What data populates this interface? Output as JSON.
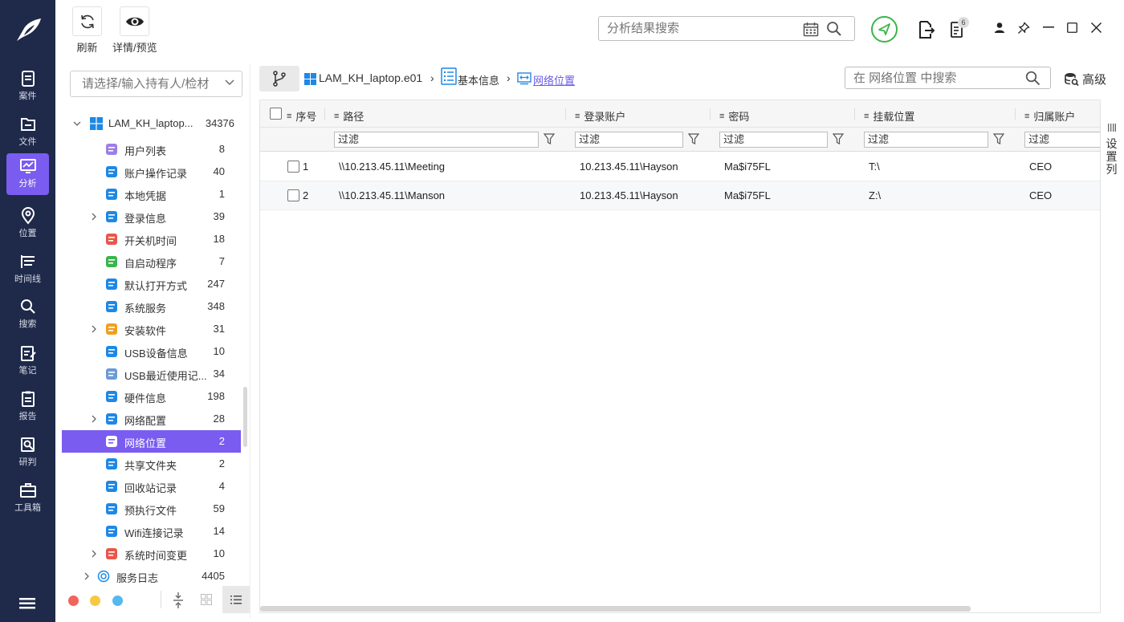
{
  "rail": {
    "items": [
      {
        "label": "案件",
        "icon": "case-icon"
      },
      {
        "label": "文件",
        "icon": "folder-icon"
      },
      {
        "label": "分析",
        "icon": "analysis-icon",
        "active": true
      },
      {
        "label": "位置",
        "icon": "location-icon"
      },
      {
        "label": "时间线",
        "icon": "timeline-icon"
      },
      {
        "label": "搜索",
        "icon": "search-icon"
      },
      {
        "label": "笔记",
        "icon": "note-icon"
      },
      {
        "label": "报告",
        "icon": "report-icon"
      },
      {
        "label": "研判",
        "icon": "research-icon"
      },
      {
        "label": "工具箱",
        "icon": "toolbox-icon"
      }
    ]
  },
  "toolbar": {
    "refresh_label": "刷新",
    "preview_label": "详情/预览",
    "search_placeholder": "分析结果搜索",
    "task_badge": "6"
  },
  "sidebar": {
    "holder_placeholder": "请选择/输入持有人/检材",
    "root": {
      "label": "LAM_KH_laptop...",
      "count": "34376"
    },
    "items": [
      {
        "label": "用户列表",
        "count": "8"
      },
      {
        "label": "账户操作记录",
        "count": "40"
      },
      {
        "label": "本地凭据",
        "count": "1"
      },
      {
        "label": "登录信息",
        "count": "39"
      },
      {
        "label": "开关机时间",
        "count": "18"
      },
      {
        "label": "自启动程序",
        "count": "7"
      },
      {
        "label": "默认打开方式",
        "count": "247"
      },
      {
        "label": "系统服务",
        "count": "348"
      },
      {
        "label": "安装软件",
        "count": "31"
      },
      {
        "label": "USB设备信息",
        "count": "10"
      },
      {
        "label": "USB最近使用记...",
        "count": "34"
      },
      {
        "label": "硬件信息",
        "count": "198"
      },
      {
        "label": "网络配置",
        "count": "28"
      },
      {
        "label": "网络位置",
        "count": "2"
      },
      {
        "label": "共享文件夹",
        "count": "2"
      },
      {
        "label": "回收站记录",
        "count": "4"
      },
      {
        "label": "预执行文件",
        "count": "59"
      },
      {
        "label": "Wifi连接记录",
        "count": "14"
      },
      {
        "label": "系统时间变更",
        "count": "10"
      }
    ],
    "footer_item": {
      "label": "服务日志",
      "count": "4405"
    }
  },
  "breadcrumb": {
    "evidence": "LAM_KH_laptop.e01",
    "basic_info": "基本信息",
    "current": "网络位置",
    "table_search_placeholder": "在 网络位置 中搜索",
    "advanced_label": "高级"
  },
  "table": {
    "headers": {
      "index": "序号",
      "path": "路径",
      "account": "登录账户",
      "password": "密码",
      "mount": "挂载位置",
      "owner": "归属账户"
    },
    "filter_placeholder": "过滤",
    "rows": [
      {
        "index": "1",
        "path": "\\\\10.213.45.11\\Meeting",
        "account": "10.213.45.11\\Hayson",
        "password": "Ma$i75FL",
        "mount": "T:\\",
        "owner": "CEO"
      },
      {
        "index": "2",
        "path": "\\\\10.213.45.11\\Manson",
        "account": "10.213.45.11\\Hayson",
        "password": "Ma$i75FL",
        "mount": "Z:\\",
        "owner": "CEO"
      }
    ],
    "settings_label": "设置列"
  }
}
